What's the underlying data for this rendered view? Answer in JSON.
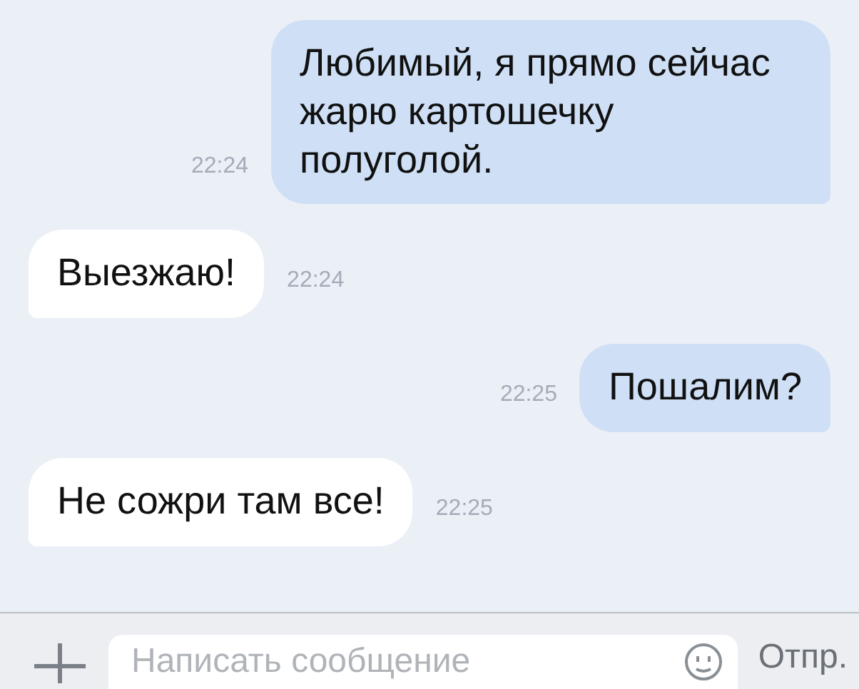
{
  "messages": [
    {
      "kind": "outgoing",
      "text": "Любимый, я прямо сейчас жарю картошечку полуголой.",
      "time": "22:24"
    },
    {
      "kind": "incoming",
      "text": "Выезжаю!",
      "time": "22:24"
    },
    {
      "kind": "outgoing",
      "text": "Пошалим?",
      "time": "22:25"
    },
    {
      "kind": "incoming",
      "text": "Не сожри там все!",
      "time": "22:25"
    }
  ],
  "composer": {
    "placeholder": "Написать сообщение",
    "send": "Отпр."
  }
}
